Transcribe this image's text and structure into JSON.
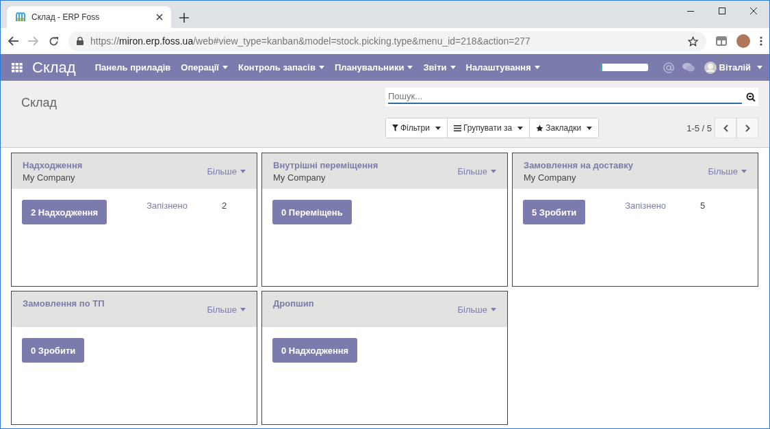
{
  "browser": {
    "tab_title": "Склад - ERP Foss",
    "url_host": "miron.erp.foss.ua",
    "url_scheme": "https://",
    "url_path": "/web#view_type=kanban&model=stock.picking.type&menu_id=218&action=277"
  },
  "navbar": {
    "app_title": "Склад",
    "menu": [
      {
        "label": "Панель приладів",
        "dropdown": false
      },
      {
        "label": "Операції",
        "dropdown": true
      },
      {
        "label": "Контроль запасів",
        "dropdown": true
      },
      {
        "label": "Планувальники",
        "dropdown": true
      },
      {
        "label": "Звіти",
        "dropdown": true
      },
      {
        "label": "Налаштування",
        "dropdown": true
      }
    ],
    "progress": {
      "level": 0.05
    },
    "user_name": "Віталій"
  },
  "control_panel": {
    "breadcrumb": "Склад",
    "search": {
      "placeholder": "Пошук..."
    },
    "buttons": [
      {
        "label": "Фільтри",
        "kind": "filter"
      },
      {
        "label": "Групувати за",
        "kind": "group"
      },
      {
        "label": "Закладки",
        "kind": "star"
      }
    ],
    "pager": "1-5 / 5"
  },
  "cards": [
    {
      "title": "Надходження",
      "company": "My Company",
      "more": "Більше",
      "action": "2 Надходження",
      "late_label": "Запізнено",
      "late_count": "2"
    },
    {
      "title": "Внутрішні переміщення",
      "company": "My Company",
      "more": "Більше",
      "action": "0 Переміщень"
    },
    {
      "title": "Замовлення на доставку",
      "company": "My Company",
      "more": "Більше",
      "action": "5 Зробити",
      "late_label": "Запізнено",
      "late_count": "5"
    },
    {
      "title": "Замовлення по ТП",
      "more": "Більше",
      "action": "0 Зробити"
    },
    {
      "title": "Дропшип",
      "more": "Більше",
      "action": "0 Надходження"
    }
  ]
}
